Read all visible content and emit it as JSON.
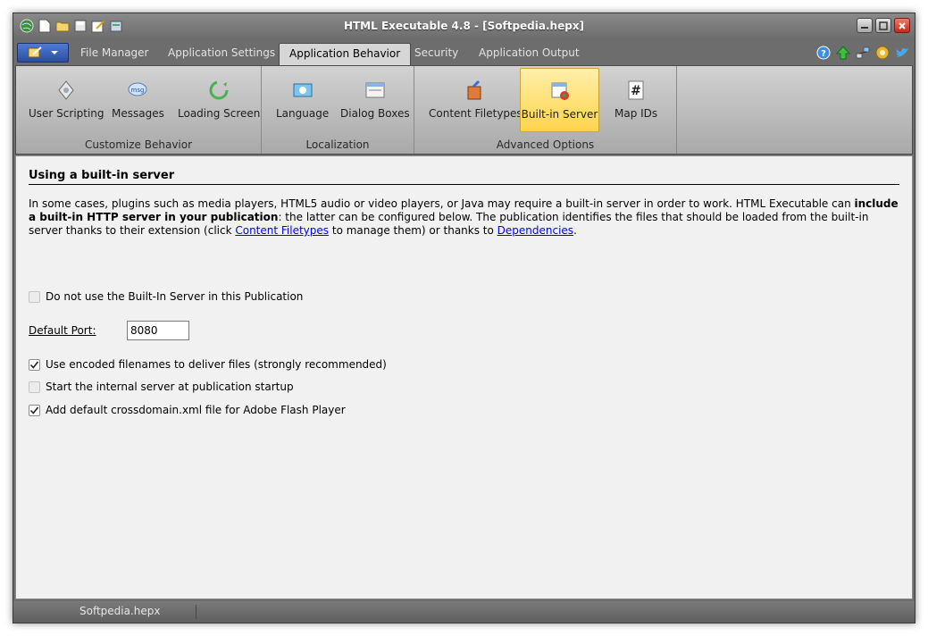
{
  "window": {
    "title": "HTML Executable 4.8 - [Softpedia.hepx]"
  },
  "quick_access": [
    "globe-icon",
    "new-document-icon",
    "open-folder-icon",
    "save-icon",
    "edit-icon",
    "build-icon"
  ],
  "tabs": [
    {
      "label": "File Manager",
      "active": false
    },
    {
      "label": "Application Settings",
      "active": false
    },
    {
      "label": "Application Behavior",
      "active": true
    },
    {
      "label": "Security",
      "active": false
    },
    {
      "label": "Application Output",
      "active": false
    }
  ],
  "ribbon": {
    "groups": [
      {
        "label": "Customize Behavior",
        "buttons": [
          {
            "label": "User Scripting",
            "icon": "script-icon"
          },
          {
            "label": "Messages",
            "icon": "messages-icon"
          },
          {
            "label": "Loading Screen",
            "icon": "loading-screen-icon"
          }
        ]
      },
      {
        "label": "Localization",
        "buttons": [
          {
            "label": "Language",
            "icon": "language-icon"
          },
          {
            "label": "Dialog Boxes",
            "icon": "dialog-boxes-icon"
          }
        ]
      },
      {
        "label": "Advanced Options",
        "buttons": [
          {
            "label": "Content Filetypes",
            "icon": "content-filetypes-icon"
          },
          {
            "label": "Built-in Server",
            "icon": "built-in-server-icon",
            "selected": true
          },
          {
            "label": "Map IDs",
            "icon": "hash-icon"
          }
        ]
      }
    ]
  },
  "content": {
    "heading": "Using a built-in server",
    "desc": {
      "p1": "In some cases, plugins such as media players, HTML5 audio or video players, or Java may require a built-in server in order to work. HTML Executable can ",
      "bold1": "include a built-in HTTP server in your publication",
      "p2": ": the latter can be configured below. The publication identifies the files that should be loaded from the built-in server thanks to their extension (click ",
      "link1": "Content Filetypes",
      "p3": " to manage them) or thanks to ",
      "link2": "Dependencies",
      "p4": "."
    },
    "disable_server": {
      "label": "Do not use the Built-In Server in this Publication",
      "checked": false
    },
    "port": {
      "label": "Default Port:",
      "value": "8080"
    },
    "options": [
      {
        "label": "Use encoded filenames to deliver files (strongly recommended)",
        "checked": true
      },
      {
        "label": "Start the internal server at publication startup",
        "checked": false
      },
      {
        "label": "Add default crossdomain.xml file for Adobe Flash Player",
        "checked": true
      }
    ]
  },
  "statusbar": {
    "document": "Softpedia.hepx"
  },
  "colors": {
    "chrome": "#6d6d6d",
    "ribbon_selected": "#ffd44c",
    "link": "#0000ee"
  }
}
